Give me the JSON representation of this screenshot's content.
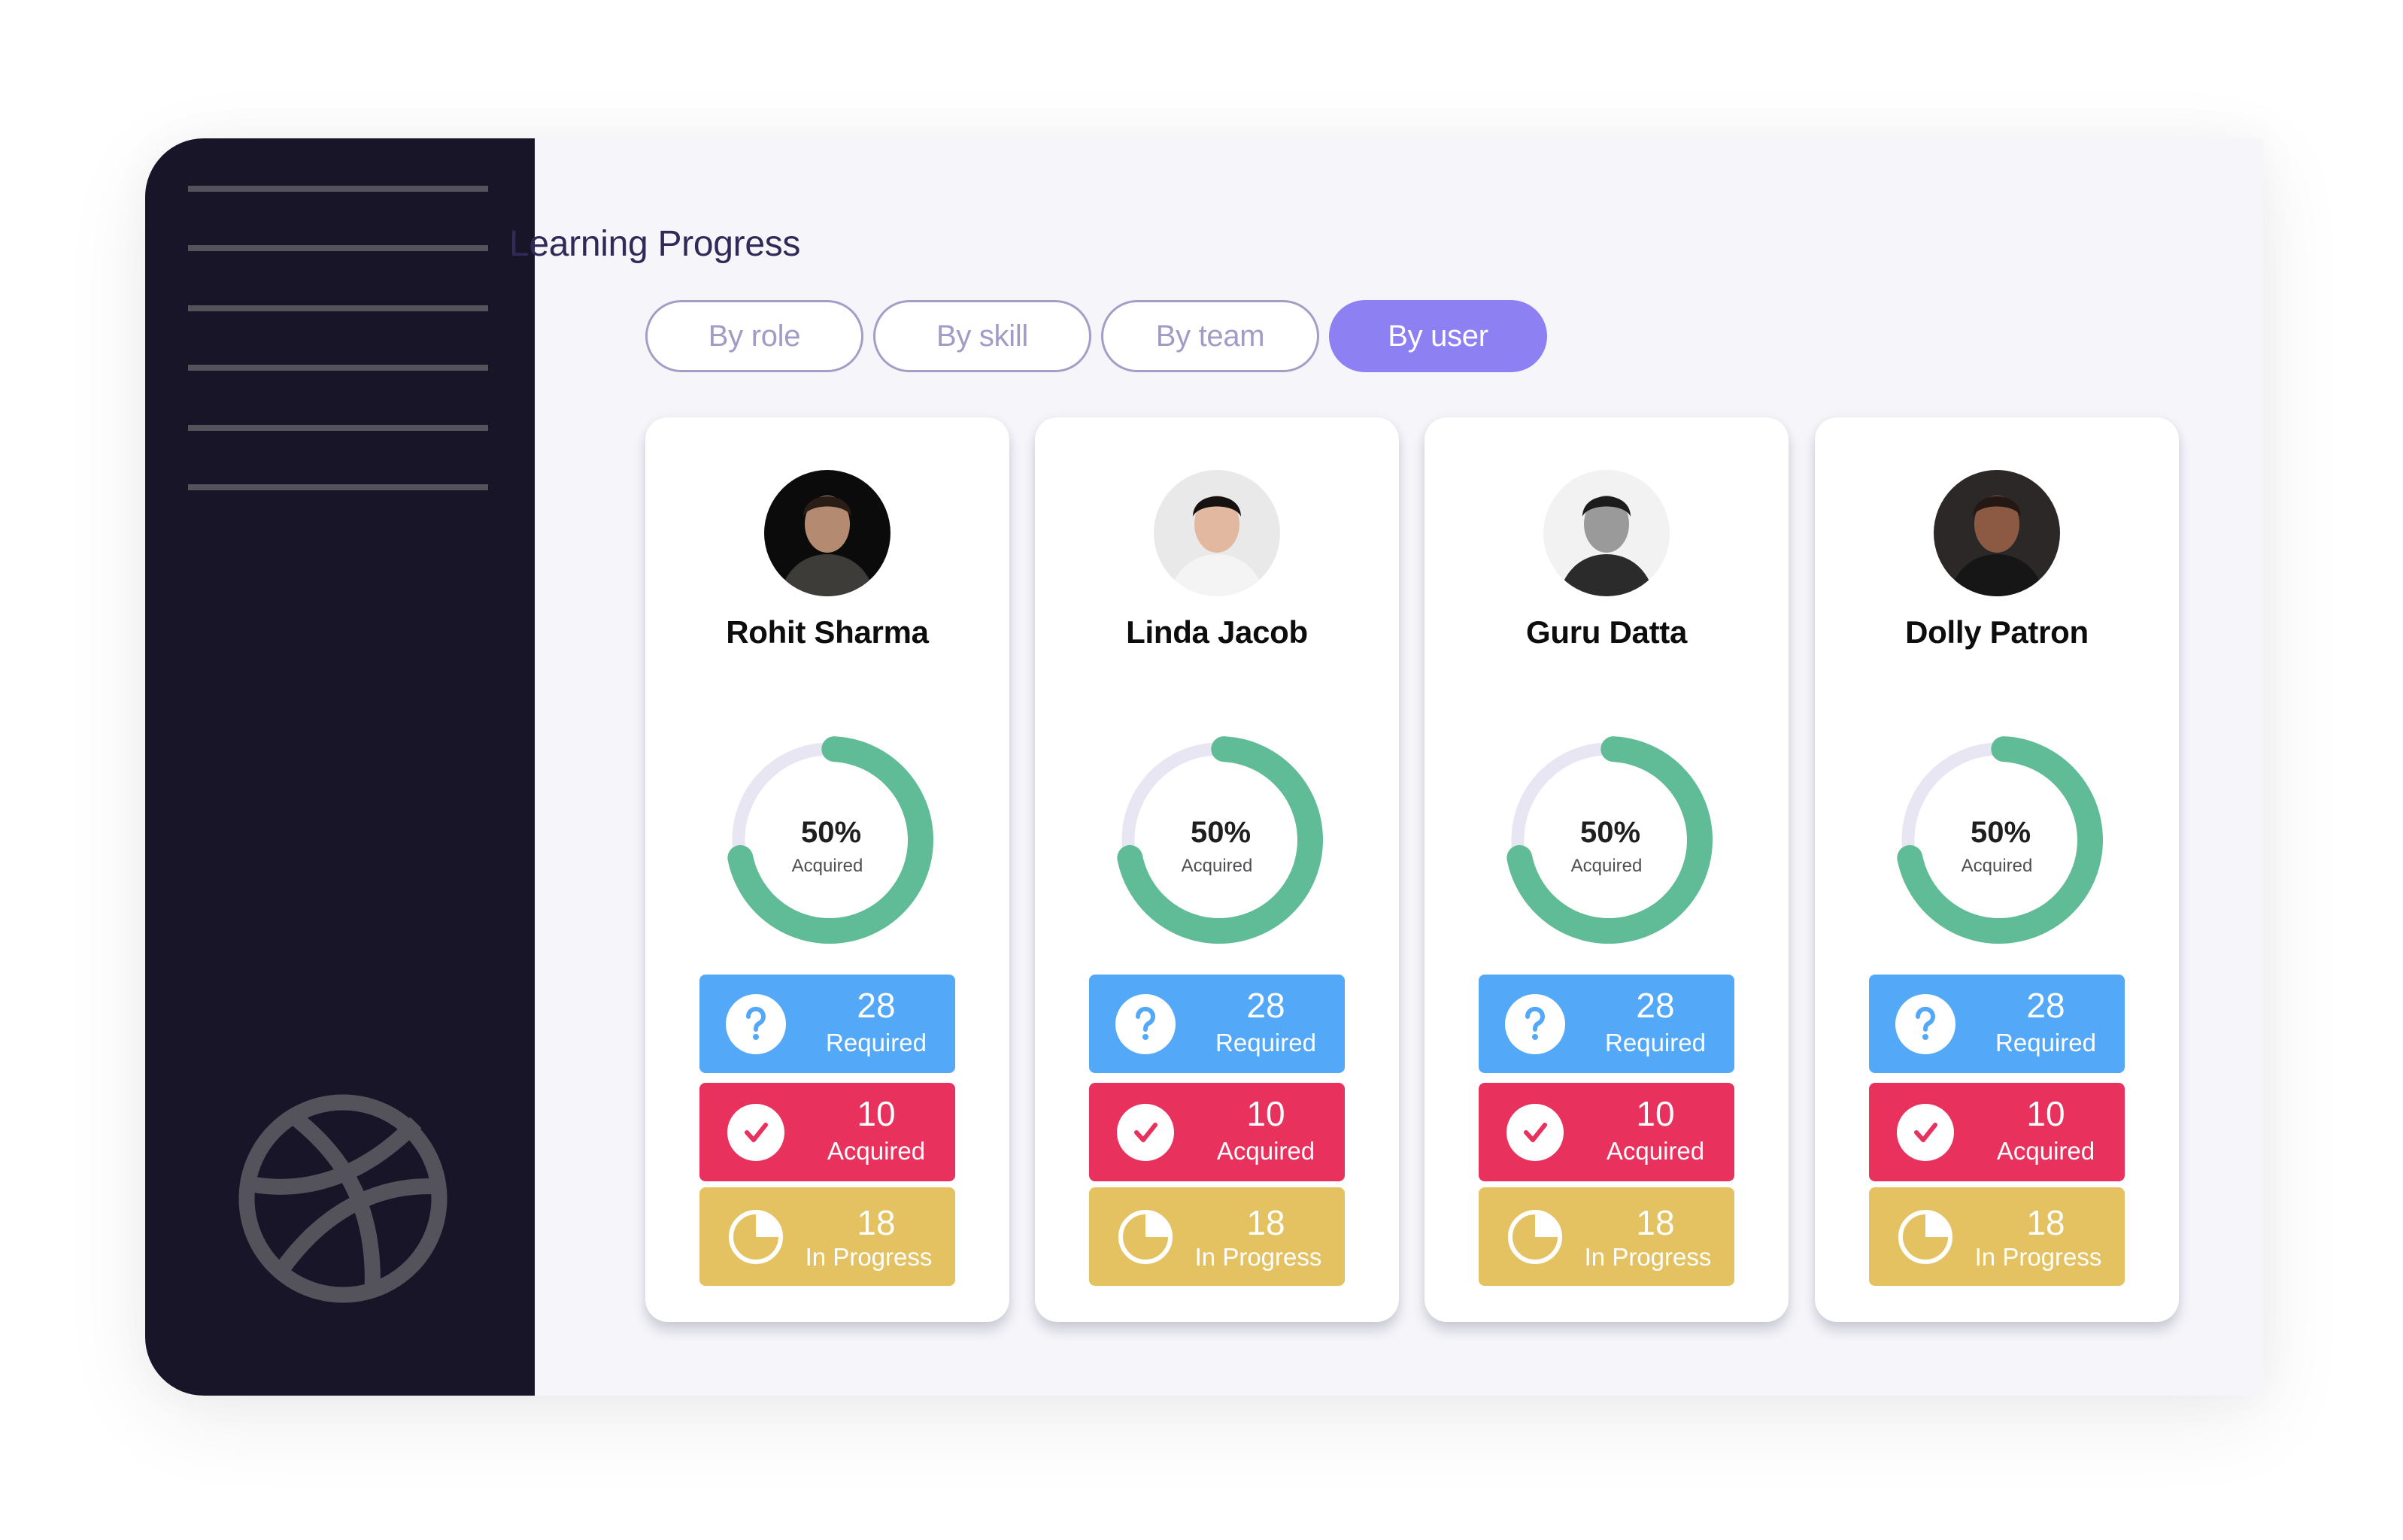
{
  "sidebar": {
    "nav_items": 6,
    "logo_icon": "dribbble-icon"
  },
  "header": {
    "title": "Learning Progress"
  },
  "filters": {
    "options": [
      {
        "label": "By role",
        "active": false
      },
      {
        "label": "By skill",
        "active": false
      },
      {
        "label": "By team",
        "active": false
      },
      {
        "label": "By user",
        "active": true
      }
    ]
  },
  "users": [
    {
      "name": "Rohit Sharma",
      "progress_label": "50%",
      "progress_caption": "Acquired",
      "ring_fill_fraction": 0.71,
      "stats": {
        "required": {
          "value": "28",
          "label": "Required",
          "icon": "question-icon"
        },
        "acquired": {
          "value": "10",
          "label": "Acquired",
          "icon": "check-icon"
        },
        "in_progress": {
          "value": "18",
          "label": "In Progress",
          "icon": "pie-clock-icon"
        }
      }
    },
    {
      "name": "Linda Jacob",
      "progress_label": "50%",
      "progress_caption": "Acquired",
      "ring_fill_fraction": 0.71,
      "stats": {
        "required": {
          "value": "28",
          "label": "Required",
          "icon": "question-icon"
        },
        "acquired": {
          "value": "10",
          "label": "Acquired",
          "icon": "check-icon"
        },
        "in_progress": {
          "value": "18",
          "label": "In Progress",
          "icon": "pie-clock-icon"
        }
      }
    },
    {
      "name": "Guru Datta",
      "progress_label": "50%",
      "progress_caption": "Acquired",
      "ring_fill_fraction": 0.71,
      "stats": {
        "required": {
          "value": "28",
          "label": "Required",
          "icon": "question-icon"
        },
        "acquired": {
          "value": "10",
          "label": "Acquired",
          "icon": "check-icon"
        },
        "in_progress": {
          "value": "18",
          "label": "In Progress",
          "icon": "pie-clock-icon"
        }
      }
    },
    {
      "name": "Dolly Patron",
      "progress_label": "50%",
      "progress_caption": "Acquired",
      "ring_fill_fraction": 0.71,
      "stats": {
        "required": {
          "value": "28",
          "label": "Required",
          "icon": "question-icon"
        },
        "acquired": {
          "value": "10",
          "label": "Acquired",
          "icon": "check-icon"
        },
        "in_progress": {
          "value": "18",
          "label": "In Progress",
          "icon": "pie-clock-icon"
        }
      }
    }
  ],
  "colors": {
    "sidebar_bg": "#181528",
    "sidebar_line": "#54535c",
    "main_bg": "#f5f5fa",
    "title": "#2f2a58",
    "filter_outline": "#a39dc8",
    "filter_active": "#8c80f2",
    "ring_fill": "#5fbc97",
    "ring_track": "#e7e6f2",
    "required": "#54a8f8",
    "acquired": "#e8325d",
    "in_progress": "#e4c261"
  }
}
